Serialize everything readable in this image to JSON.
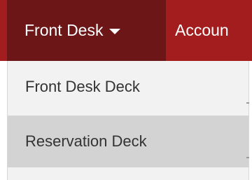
{
  "nav": {
    "active_label": "Front Desk",
    "next_label": "Accoun"
  },
  "dropdown": {
    "items": [
      {
        "label": "Front Desk Deck"
      },
      {
        "label": "Reservation Deck"
      }
    ]
  },
  "colors": {
    "navbar": "#a31d1f",
    "active": "#6c1618",
    "dropdown_bg": "#f2f2f2",
    "hover_bg": "#d3d3d3",
    "text": "#333333"
  },
  "icons": {
    "caret": "caret-down-icon"
  }
}
